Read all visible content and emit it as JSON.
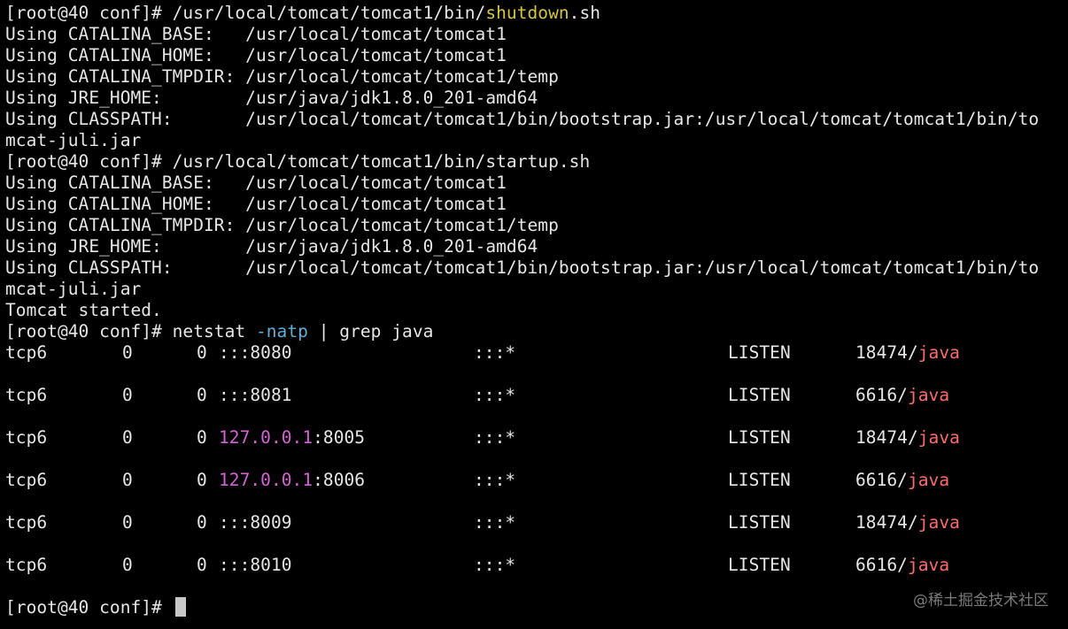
{
  "terminal": {
    "block1": {
      "prompt": "[root@40 conf]# ",
      "cmd_prefix": "/usr/local/tomcat/tomcat1/bin/",
      "cmd_name": "shutdown",
      "cmd_suffix": ".sh",
      "lines": [
        "Using CATALINA_BASE:   /usr/local/tomcat/tomcat1",
        "Using CATALINA_HOME:   /usr/local/tomcat/tomcat1",
        "Using CATALINA_TMPDIR: /usr/local/tomcat/tomcat1/temp",
        "Using JRE_HOME:        /usr/java/jdk1.8.0_201-amd64",
        "Using CLASSPATH:       /usr/local/tomcat/tomcat1/bin/bootstrap.jar:/usr/local/tomcat/tomcat1/bin/to",
        "mcat-juli.jar"
      ]
    },
    "block2": {
      "prompt": "[root@40 conf]# ",
      "cmd": "/usr/local/tomcat/tomcat1/bin/startup.sh",
      "lines": [
        "Using CATALINA_BASE:   /usr/local/tomcat/tomcat1",
        "Using CATALINA_HOME:   /usr/local/tomcat/tomcat1",
        "Using CATALINA_TMPDIR: /usr/local/tomcat/tomcat1/temp",
        "Using JRE_HOME:        /usr/java/jdk1.8.0_201-amd64",
        "Using CLASSPATH:       /usr/local/tomcat/tomcat1/bin/bootstrap.jar:/usr/local/tomcat/tomcat1/bin/to",
        "mcat-juli.jar",
        "Tomcat started."
      ]
    },
    "block3": {
      "prompt": "[root@40 conf]# ",
      "cmd_a": "netstat ",
      "cmd_opt": "-natp",
      "cmd_b": " | grep java",
      "rows": [
        {
          "proto": "tcp6",
          "recv": "0",
          "send": "0",
          "local_ip": "",
          "local_rest": ":::8080",
          "foreign": ":::*",
          "state": "LISTEN",
          "pid": "18474/",
          "prog": "java"
        },
        {
          "proto": "tcp6",
          "recv": "0",
          "send": "0",
          "local_ip": "",
          "local_rest": ":::8081",
          "foreign": ":::*",
          "state": "LISTEN",
          "pid": "6616/",
          "prog": "java"
        },
        {
          "proto": "tcp6",
          "recv": "0",
          "send": "0",
          "local_ip": "127.0.0.1",
          "local_rest": ":8005",
          "foreign": ":::*",
          "state": "LISTEN",
          "pid": "18474/",
          "prog": "java"
        },
        {
          "proto": "tcp6",
          "recv": "0",
          "send": "0",
          "local_ip": "127.0.0.1",
          "local_rest": ":8006",
          "foreign": ":::*",
          "state": "LISTEN",
          "pid": "6616/",
          "prog": "java"
        },
        {
          "proto": "tcp6",
          "recv": "0",
          "send": "0",
          "local_ip": "",
          "local_rest": ":::8009",
          "foreign": ":::*",
          "state": "LISTEN",
          "pid": "18474/",
          "prog": "java"
        },
        {
          "proto": "tcp6",
          "recv": "0",
          "send": "0",
          "local_ip": "",
          "local_rest": ":::8010",
          "foreign": ":::*",
          "state": "LISTEN",
          "pid": "6616/",
          "prog": "java"
        }
      ]
    },
    "final_prompt": "[root@40 conf]# "
  },
  "watermark": "@稀土掘金技术社区",
  "colors": {
    "background": "#000000",
    "text": "#e6e6e6",
    "highlight_command": "#d6c53b",
    "option": "#5fafd7",
    "ip": "#d75fd7",
    "program": "#ff6b6b"
  }
}
